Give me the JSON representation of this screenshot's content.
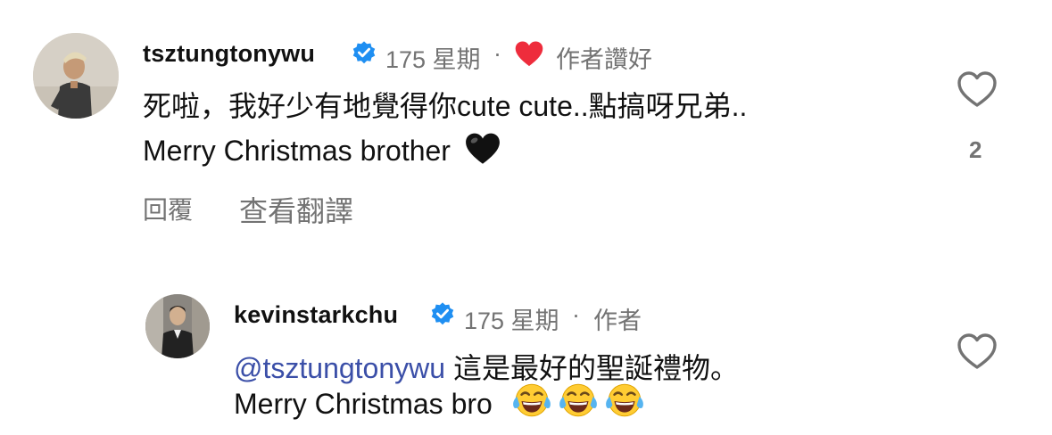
{
  "comment1": {
    "username": "tsztungtonywu",
    "time": "175 星期",
    "separator": "·",
    "author_liked": "作者讚好",
    "line1": "死啦，我好少有地覺得你cute cute..點搞呀兄弟..",
    "line2": "Merry Christmas brother",
    "reply": "回覆",
    "translate": "查看翻譯",
    "like_count": "2",
    "icons": {
      "verified": "verified-badge-icon",
      "author_heart": "red-heart-icon",
      "black_heart": "black-heart-emoji",
      "like": "heart-outline-icon"
    },
    "colors": {
      "verified": "#1f8ff2",
      "author_heart": "#ee2c3c",
      "black_heart": "#111111"
    }
  },
  "comment2": {
    "username": "kevinstarkchu",
    "time": "175 星期",
    "separator": "·",
    "author": "作者",
    "mention": "@tsztungtonywu",
    "line1_rest": " 這是最好的聖誕禮物。",
    "line2": "Merry Christmas bro",
    "icons": {
      "verified": "verified-badge-icon",
      "emojis": [
        "tears-of-joy-emoji",
        "tears-of-joy-emoji",
        "tears-of-joy-emoji"
      ],
      "like": "heart-outline-icon"
    },
    "colors": {
      "mention": "#3b4fa8"
    }
  }
}
